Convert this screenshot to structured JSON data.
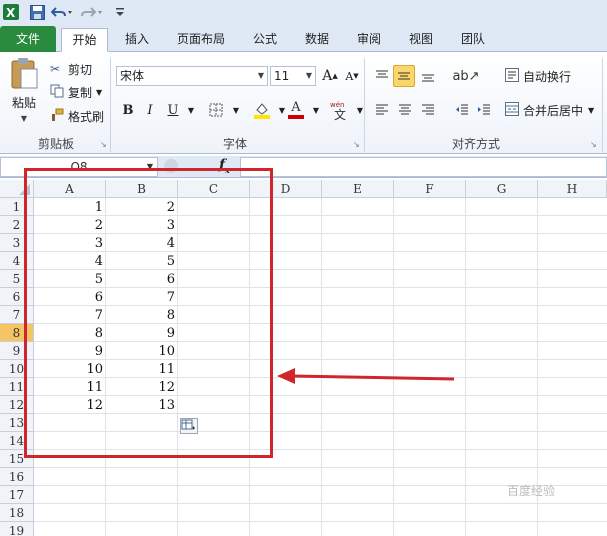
{
  "tabs": [
    "文件",
    "开始",
    "插入",
    "页面布局",
    "公式",
    "数据",
    "审阅",
    "视图",
    "团队"
  ],
  "clipboard": {
    "paste_label": "粘贴",
    "cut_label": "剪切",
    "copy_label": "复制",
    "format_painter_label": "格式刷",
    "group_label": "剪贴板"
  },
  "font": {
    "font_name": "宋体",
    "font_size": "11",
    "bold": "B",
    "italic": "I",
    "underline": "U",
    "group_label": "字体",
    "colors": {
      "highlight": "#ffe600",
      "font": "#d00000"
    }
  },
  "alignment": {
    "wrap_label": "自动换行",
    "merge_label": "合并后居中",
    "group_label": "对齐方式"
  },
  "formula_bar": {
    "name_box": "O8",
    "fx": "f"
  },
  "sheet": {
    "columns": [
      "A",
      "B",
      "C",
      "D",
      "E",
      "F",
      "G",
      "H"
    ],
    "rows": [
      "1",
      "2",
      "3",
      "4",
      "5",
      "6",
      "7",
      "8",
      "9",
      "10",
      "11",
      "12",
      "13",
      "14",
      "15",
      "16",
      "17",
      "18",
      "19"
    ],
    "selected_row": "8",
    "values_a": [
      "1",
      "2",
      "3",
      "4",
      "5",
      "6",
      "7",
      "8",
      "9",
      "10",
      "11",
      "12"
    ],
    "values_b": [
      "2",
      "3",
      "4",
      "5",
      "6",
      "7",
      "8",
      "9",
      "10",
      "11",
      "12",
      "13"
    ]
  },
  "annotation": {
    "color": "#d0252a"
  },
  "watermark": "百度经验"
}
